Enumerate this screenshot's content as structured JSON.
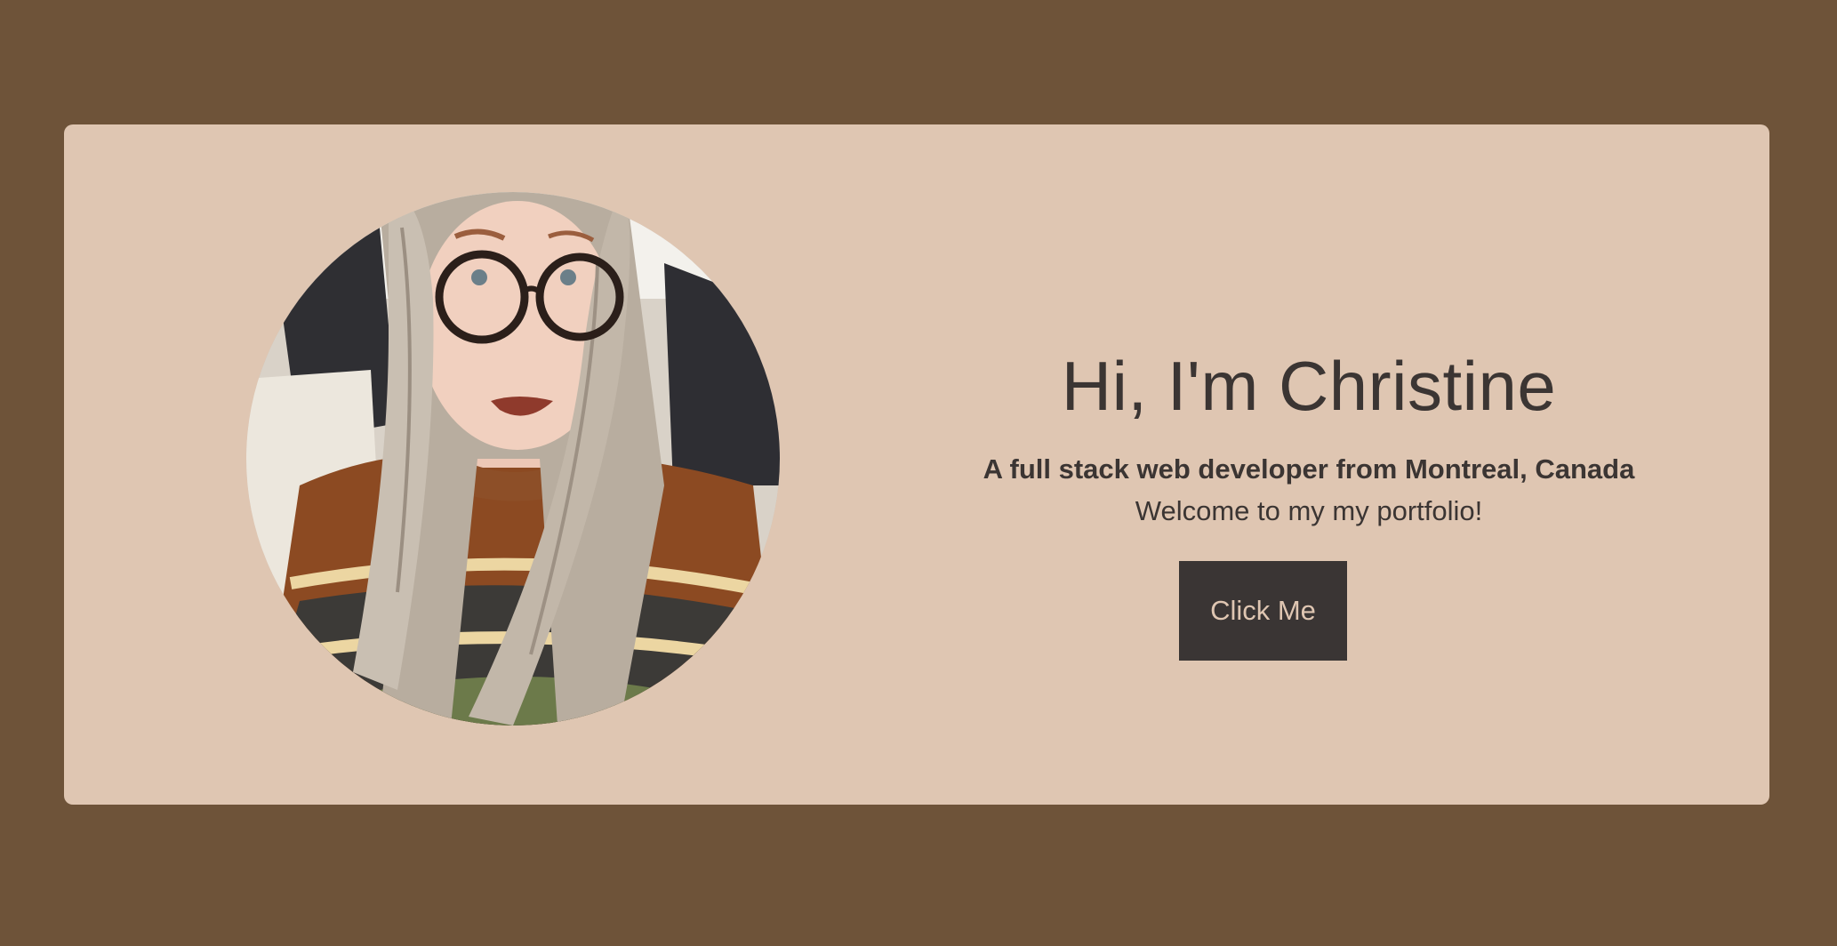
{
  "hero": {
    "greeting": "Hi, I'm Christine",
    "tagline": "A full stack web developer from Montreal, Canada",
    "welcome": "Welcome to my my portfolio!",
    "button_label": "Click Me"
  },
  "colors": {
    "page_background": "#6e5339",
    "card_background": "#dfc6b2",
    "text": "#3b3533",
    "button_background": "#3a3534",
    "button_text": "#dfc6b2"
  }
}
